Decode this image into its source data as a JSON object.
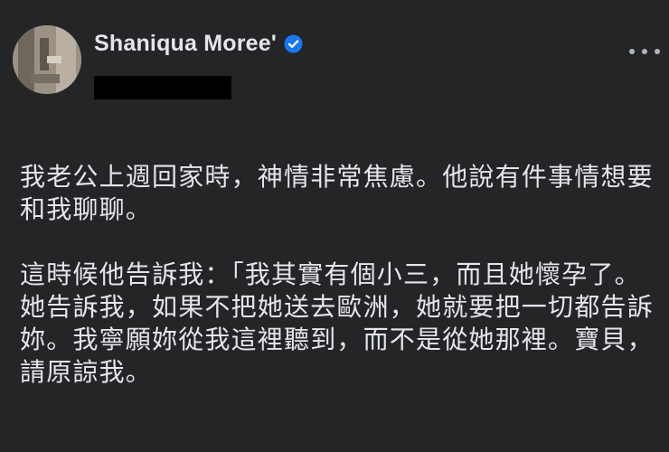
{
  "post": {
    "author_name": "Shaniqua Moree'",
    "verified": true,
    "icons": {
      "avatar": "profile-photo",
      "verified": "verified-badge-icon",
      "more": "more-options-icon"
    },
    "paragraphs": [
      "我老公上週回家時，神情非常焦慮。他說有件事情想要和我聊聊。",
      "這時候他告訴我：「我其實有個小三，而且她懷孕了。她告訴我，如果不把她送去歐洲，她就要把一切都告訴妳。我寧願妳從我這裡聽到，而不是從她那裡。寶貝，請原諒我。"
    ]
  },
  "colors": {
    "background": "#242526",
    "text": "#e4e6eb",
    "verified": "#1877f2",
    "redaction": "#000000"
  }
}
